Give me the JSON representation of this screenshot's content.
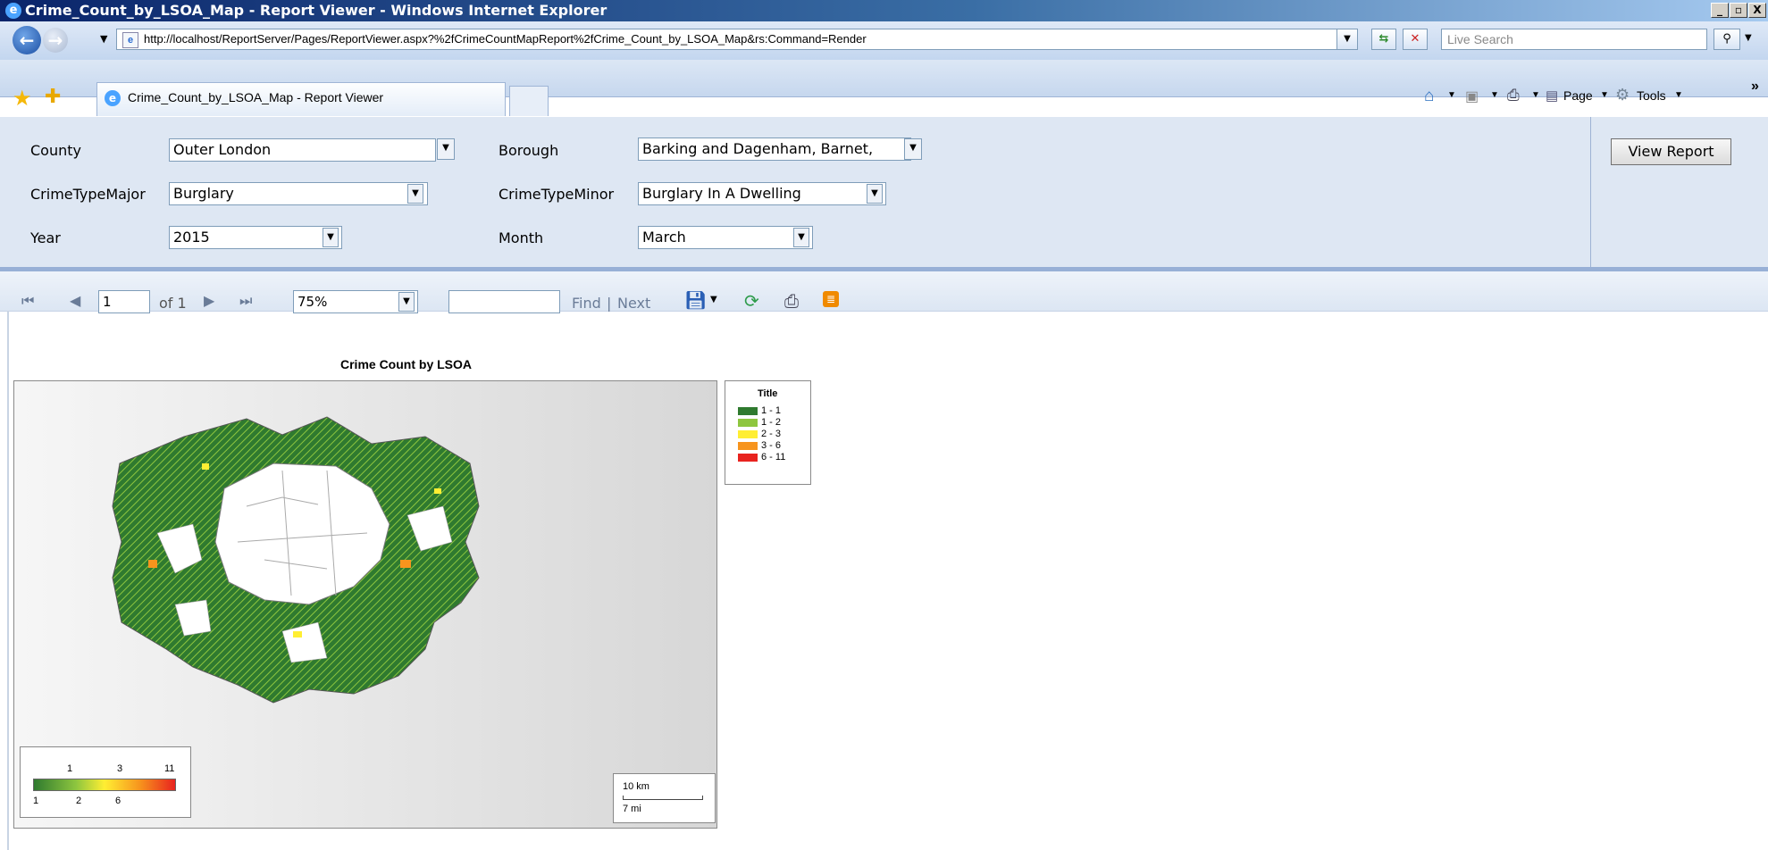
{
  "window": {
    "title": "Crime_Count_by_LSOA_Map - Report Viewer - Windows Internet Explorer",
    "min_btn": "_",
    "max_btn": "▫",
    "close_btn": "X"
  },
  "address_bar": {
    "url": "http://localhost/ReportServer/Pages/ReportViewer.aspx?%2fCrimeCountMapReport%2fCrime_Count_by_LSOA_Map&rs:Command=Render",
    "search_placeholder": "Live Search"
  },
  "tabs": {
    "active_tab_label": "Crime_Count_by_LSOA_Map - Report Viewer"
  },
  "command_bar": {
    "page_label": "Page",
    "tools_label": "Tools"
  },
  "parameters": {
    "county_label": "County",
    "county_value": "Outer London",
    "borough_label": "Borough",
    "borough_value": "Barking and Dagenham, Barnet,",
    "crime_major_label": "CrimeTypeMajor",
    "crime_major_value": "Burglary",
    "crime_minor_label": "CrimeTypeMinor",
    "crime_minor_value": "Burglary In A Dwelling",
    "year_label": "Year",
    "year_value": "2015",
    "month_label": "Month",
    "month_value": "March",
    "view_report_label": "View Report"
  },
  "report_toolbar": {
    "page_value": "1",
    "of_pages": "of 1",
    "zoom_value": "75%",
    "find_label": "Find",
    "separator": "|",
    "next_label": "Next"
  },
  "map": {
    "title": "Crime Count by LSOA",
    "legend_title": "Title",
    "legend_items": [
      {
        "label": "1 - 1",
        "color": "#2f7a2f"
      },
      {
        "label": "1 - 2",
        "color": "#8ec63f"
      },
      {
        "label": "2 - 3",
        "color": "#ffee33"
      },
      {
        "label": "3 - 6",
        "color": "#f7941d"
      },
      {
        "label": "6 - 11",
        "color": "#e8231f"
      }
    ],
    "color_scale": {
      "top_labels": [
        "1",
        "3",
        "11"
      ],
      "bottom_labels": [
        "1",
        "2",
        "6"
      ]
    },
    "scale_bar": {
      "km": "10 km",
      "mi": "7 mi"
    }
  }
}
